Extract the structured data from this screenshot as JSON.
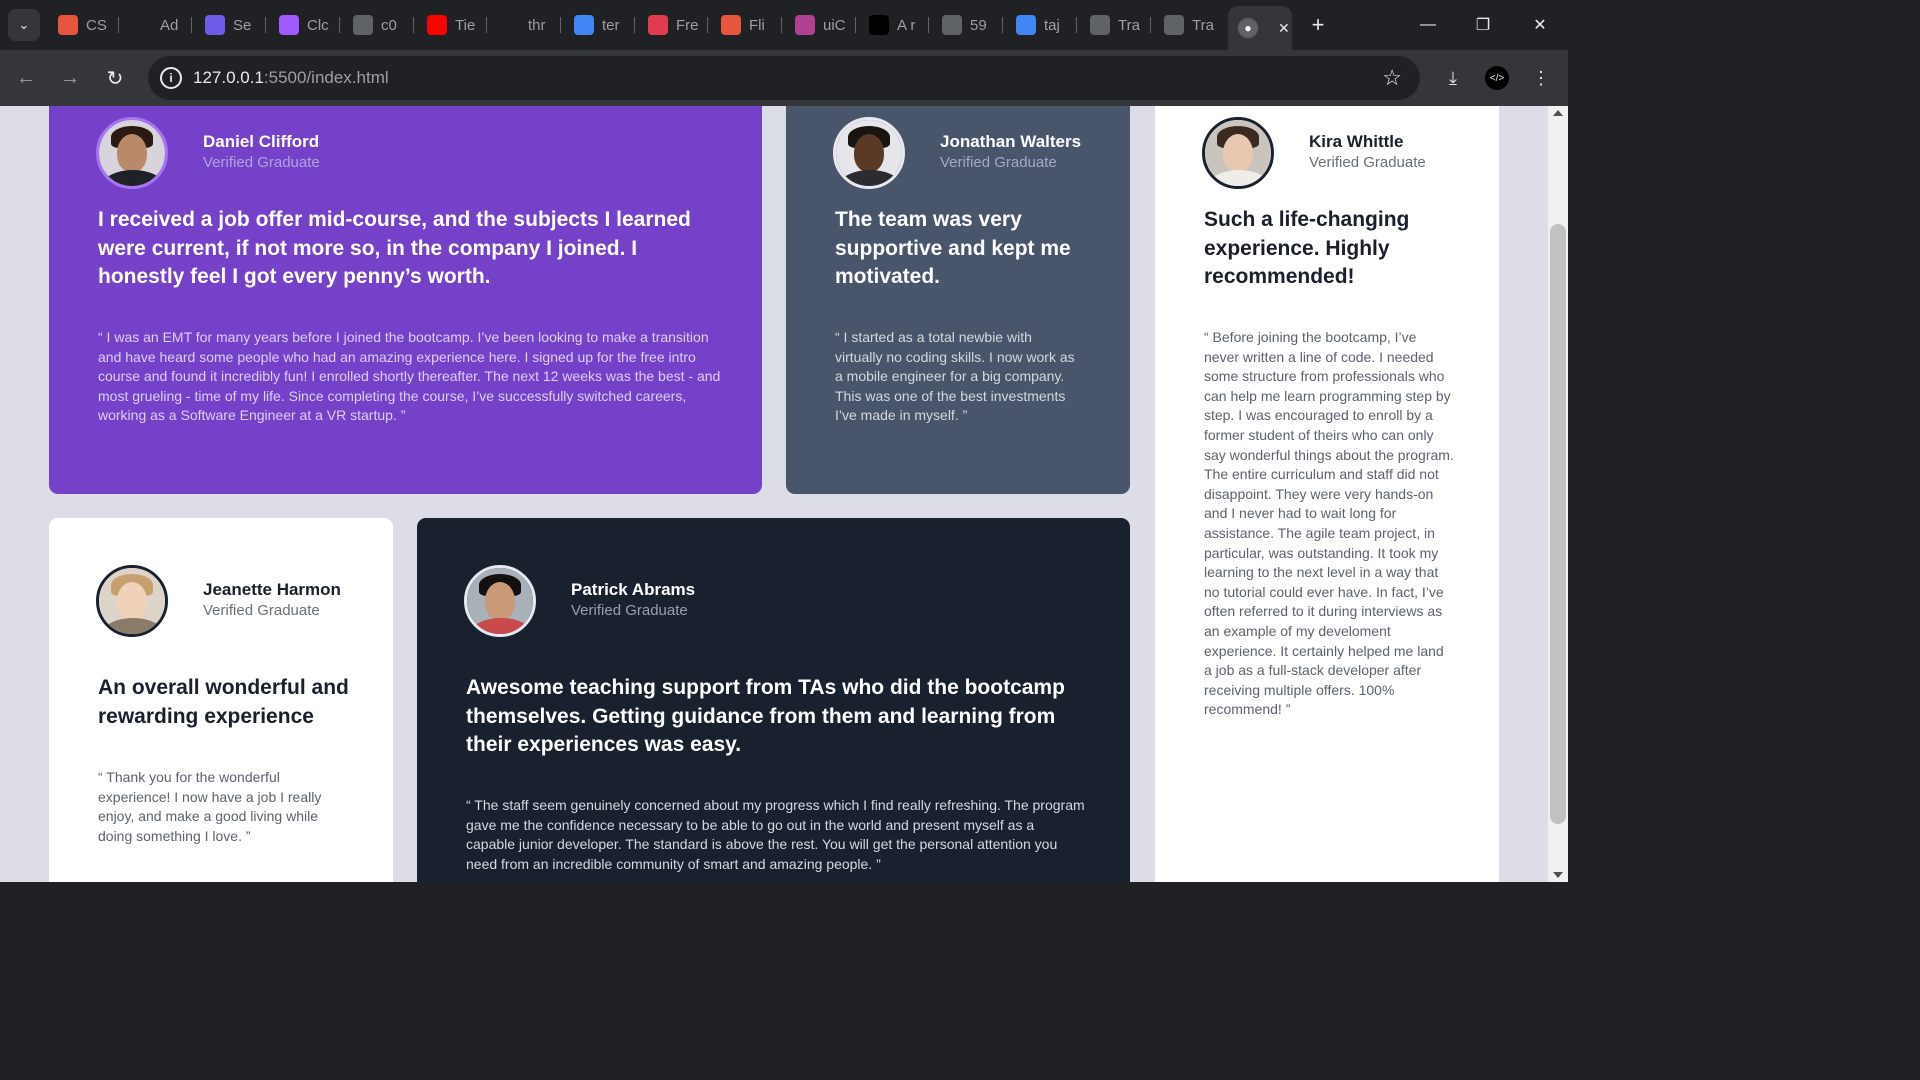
{
  "browser": {
    "tabs": [
      {
        "title": "CS",
        "favicon": "asterisk-icon",
        "color": "#e8553f"
      },
      {
        "title": "Ad",
        "favicon": "dark-app-icon",
        "color": "#202124"
      },
      {
        "title": "Se",
        "favicon": "colorful-app-icon",
        "color": "#6d5ce8"
      },
      {
        "title": "Clc",
        "favicon": "figma-icon",
        "color": "#a259ff"
      },
      {
        "title": "c0",
        "favicon": "globe-icon",
        "color": "#5f6368"
      },
      {
        "title": "Tie",
        "favicon": "youtube-icon",
        "color": "#ff0000"
      },
      {
        "title": "thr",
        "favicon": "m-logo-icon",
        "color": "#202124"
      },
      {
        "title": "ter",
        "favicon": "google-icon",
        "color": "#4285f4"
      },
      {
        "title": "Fre",
        "favicon": "frontend-mentor-icon",
        "color": "#e03b4f"
      },
      {
        "title": "Fli",
        "favicon": "mmt-icon",
        "color": "#e8553f"
      },
      {
        "title": "uiC",
        "favicon": "gradient-app-icon",
        "color": "#b04090"
      },
      {
        "title": "A r",
        "favicon": "black-logo-icon",
        "color": "#000000"
      },
      {
        "title": "59",
        "favicon": "globe-icon",
        "color": "#5f6368"
      },
      {
        "title": "taj",
        "favicon": "google-icon",
        "color": "#4285f4"
      },
      {
        "title": "Tra",
        "favicon": "globe-icon",
        "color": "#5f6368"
      },
      {
        "title": "Tra",
        "favicon": "globe-icon",
        "color": "#5f6368"
      }
    ],
    "url_host": "127.0.0.1",
    "url_rest": ":5500/index.html"
  },
  "testimonials": {
    "daniel": {
      "name": "Daniel Clifford",
      "role": "Verified Graduate",
      "headline": "I received a job offer mid-course, and the subjects I learned were current, if not more so, in the company I joined. I honestly feel I got every penny’s worth.",
      "quote": "“ I was an EMT for many years before I joined the bootcamp. I’ve been looking to make a transition and have heard some people who had an amazing experience here. I signed up for the free intro course and found it incredibly fun! I enrolled shortly thereafter. The next 12 weeks was the best - and most grueling - time of my life. Since completing the course, I’ve successfully switched careers, working as a Software Engineer at a VR startup. ”"
    },
    "jonathan": {
      "name": "Jonathan Walters",
      "role": "Verified Graduate",
      "headline": "The team was very supportive and kept me motivated.",
      "quote": "“ I started as a total newbie with virtually no coding skills. I now work as a mobile engineer for a big company. This was one of the best investments I’ve made in myself. ”"
    },
    "kira": {
      "name": "Kira Whittle",
      "role": "Verified Graduate",
      "headline": "Such a life-changing experience. Highly recommended!",
      "quote": "“ Before joining the bootcamp, I’ve never written a line of code. I needed some structure from professionals who can help me learn programming step by step. I was encouraged to enroll by a former student of theirs who can only say wonderful things about the program. The entire curriculum and staff did not disappoint. They were very hands-on and I never had to wait long for assistance. The agile team project, in particular, was outstanding. It took my learning to the next level in a way that no tutorial could ever have. In fact, I’ve often referred to it during interviews as an example of my develoment experience. It certainly helped me land a job as a full-stack developer after receiving multiple offers. 100% recommend! ”"
    },
    "jeanette": {
      "name": "Jeanette Harmon",
      "role": "Verified Graduate",
      "headline": "An overall wonderful and rewarding experience",
      "quote": "“ Thank you for the wonderful experience! I now have a job I really enjoy, and make a good living while doing something I love. ”"
    },
    "patrick": {
      "name": "Patrick Abrams",
      "role": "Verified Graduate",
      "headline": "Awesome teaching support from TAs who did the bootcamp themselves. Getting guidance from them and learning from their experiences was easy.",
      "quote": "“ The staff seem genuinely concerned about my progress which I find really refreshing. The program gave me the confidence necessary to be able to go out in the world and present myself as a capable junior developer. The standard is above the rest. You will get the personal attention you need from an incredible community of smart and amazing people. ”"
    }
  },
  "colors": {
    "page_bg": "#dcdde7",
    "purple": "#7541c8",
    "slate": "#48556a",
    "dark": "#19212e",
    "white": "#ffffff"
  }
}
